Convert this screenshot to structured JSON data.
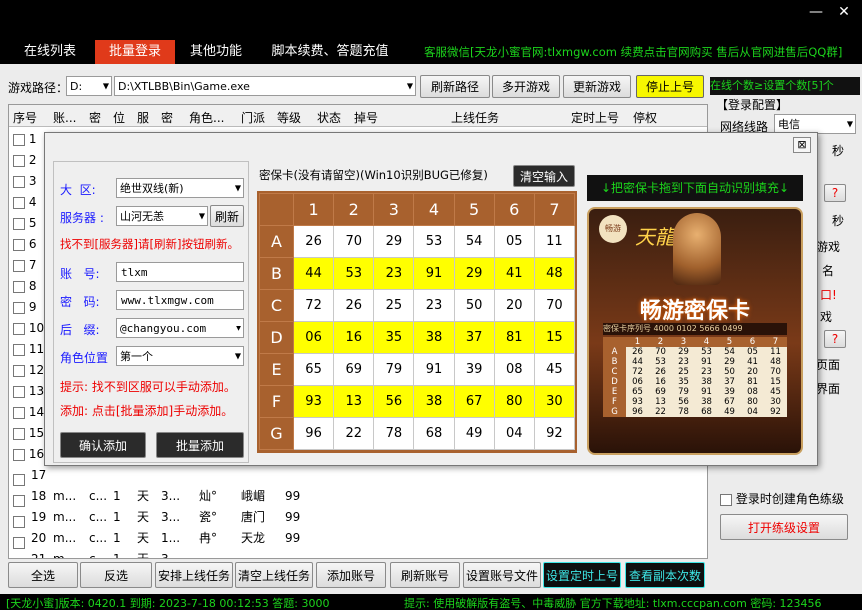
{
  "tabs": [
    "在线列表",
    "批量登录",
    "其他功能",
    "脚本续费、答题充值"
  ],
  "active_tab": 1,
  "notice": "客服微信[天龙小蜜官网:tlxmgw.com 续费点击官网购买 售后从官网进售后QQ群]",
  "game_path": {
    "label": "游戏路径：",
    "drive": "D:",
    "path": "D:\\XTLBB\\Bin\\Game.exe"
  },
  "top_buttons": {
    "refresh_path": "刷新路径",
    "multi_open": "多开游戏",
    "update_game": "更新游戏",
    "stop_login": "停止上号"
  },
  "online_notice": "在线个数≥设置个数[5]个",
  "columns": [
    "序号",
    "账...",
    "密",
    "位",
    "服",
    "密",
    "角色...",
    "门派",
    "等级",
    "状态",
    "掉号",
    "上线任务",
    "定时上号",
    "停权"
  ],
  "rows": [
    {
      "no": "17",
      "acc": "",
      "pw": "",
      "pos": "",
      "srv": "",
      "pw2": "",
      "role": "",
      "sect": "",
      "level": ""
    },
    {
      "no": "18",
      "acc": "m...",
      "pw": "c...",
      "pos": "1",
      "srv": "天",
      "pw2": "3...",
      "role": "灿°",
      "sect": "峨嵋",
      "level": "99"
    },
    {
      "no": "19",
      "acc": "m...",
      "pw": "c...",
      "pos": "1",
      "srv": "天",
      "pw2": "3...",
      "role": "瓷°",
      "sect": "唐门",
      "level": "99"
    },
    {
      "no": "20",
      "acc": "m...",
      "pw": "c...",
      "pos": "1",
      "srv": "天",
      "pw2": "1...",
      "role": "冉°",
      "sect": "天龙",
      "level": "99"
    },
    {
      "no": "21",
      "acc": "m...",
      "pw": "c...",
      "pos": "1",
      "srv": "天",
      "pw2": "3...",
      "role": "",
      "sect": "",
      "level": ""
    }
  ],
  "row_numbers": [
    "1",
    "2",
    "3",
    "4",
    "5",
    "6",
    "7",
    "8",
    "9",
    "10",
    "11",
    "12",
    "13",
    "14",
    "15",
    "16"
  ],
  "right_panel": {
    "title": "【登录配置】",
    "line_label": "网络线路",
    "line_value": "电信",
    "sec": "秒",
    "q": "?",
    "game_text": "游戏",
    "name_text": "名",
    "mouth_text": "口!",
    "play_text": "戏",
    "page_text": "页面",
    "ui_text": "界面",
    "create_role": "登录时创建角色练级",
    "open_leveling": "打开练级设置"
  },
  "dialog": {
    "close": "⊠",
    "region_label": "大  区:",
    "region_value": "绝世双线(新)",
    "server_label": "服务器 :",
    "server_value": "山河无恙",
    "refresh": "刷新",
    "server_hint": "找不到[服务器]请[刷新]按钮刷新。",
    "account_label": "账   号:",
    "account_value": "tlxm",
    "password_label": "密   码:",
    "password_value": "www.tlxmgw.com",
    "suffix_label": "后   缀:",
    "suffix_value": "@changyou.com",
    "role_label": "角色位置",
    "role_value": "第一个",
    "tip1": "提示: 找不到区服可以手动添加。",
    "tip2": "添加: 点击[批量添加]手动添加。",
    "confirm": "确认添加",
    "batch": "批量添加",
    "card_title": "密保卡(没有请留空)(Win10识别BUG已修复)",
    "clear": "清空输入",
    "drag_hint": "↓把密保卡拖到下面自动识别填充↓",
    "card_cols": [
      "1",
      "2",
      "3",
      "4",
      "5",
      "6",
      "7"
    ],
    "card_rows": [
      {
        "r": "A",
        "v": [
          "26",
          "70",
          "29",
          "53",
          "54",
          "05",
          "11"
        ],
        "y": false
      },
      {
        "r": "B",
        "v": [
          "44",
          "53",
          "23",
          "91",
          "29",
          "41",
          "48"
        ],
        "y": true
      },
      {
        "r": "C",
        "v": [
          "72",
          "26",
          "25",
          "23",
          "50",
          "20",
          "70"
        ],
        "y": false
      },
      {
        "r": "D",
        "v": [
          "06",
          "16",
          "35",
          "38",
          "37",
          "81",
          "15"
        ],
        "y": true
      },
      {
        "r": "E",
        "v": [
          "65",
          "69",
          "79",
          "91",
          "39",
          "08",
          "45"
        ],
        "y": false
      },
      {
        "r": "F",
        "v": [
          "93",
          "13",
          "56",
          "38",
          "67",
          "80",
          "30"
        ],
        "y": true
      },
      {
        "r": "G",
        "v": [
          "96",
          "22",
          "78",
          "68",
          "49",
          "04",
          "92"
        ],
        "y": false
      }
    ],
    "poster": {
      "brand": "天龍八部",
      "title": "畅游密保卡",
      "serial_label": "密保卡序列号",
      "serial": "4000 0102 5666 0499",
      "seal": "畅游"
    }
  },
  "bottom_buttons": [
    "全选",
    "反选",
    "安排上线任务",
    "清空上线任务",
    "添加账号",
    "刷新账号",
    "设置账号文件",
    "设置定时上号",
    "查看副本次数"
  ],
  "status": {
    "left": "[天龙小蜜]版本: 0420.1  到期: 2023-7-18 00:12:53  答题: 3000",
    "right": "提示: 使用破解版有盗号、中毒威胁 官方下载地址: tlxm.cccpan.com 密码: 123456"
  },
  "window_controls": {
    "min": "—",
    "close": "✕"
  }
}
